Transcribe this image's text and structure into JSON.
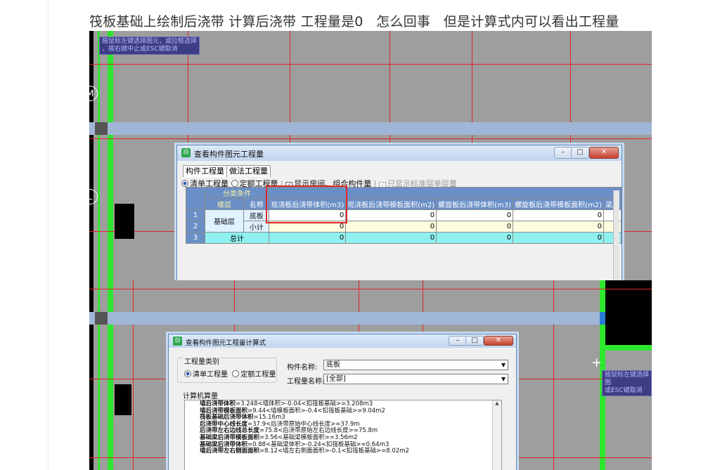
{
  "post": {
    "title": "筏板基础上绘制后浇带 计算后浇带 工程量是0   怎么回事   但是计算式内可以看出工程量"
  },
  "cad": {
    "hint_lines": [
      "按鼠标左键选择图元，或拉框选择",
      "，按右键中止或ESC键取消"
    ],
    "hint2_lines": [
      "按鼠标左键选择图",
      "或ESC键取消"
    ],
    "axis_labels": [
      "M",
      "L"
    ]
  },
  "dialog1": {
    "title": "查看构件图元工程量",
    "tabs": [
      "构件工程量",
      "做法工程量"
    ],
    "options": {
      "qingdan": "清单工程量",
      "dinge": "定额工程量",
      "show_floor": "显示房间、组合构件量",
      "only_std": "只显示标准层单层量"
    },
    "table": {
      "group_header": "分类条件",
      "col_floor": "楼层",
      "col_name": "名称",
      "columns": [
        "现浇板后浇带体积(m3)",
        "现浇板后浇带模板面积(m2)",
        "螺旋板后浇带体积(m3)",
        "螺旋板后浇带模板面积(m2)",
        "梁后"
      ],
      "rows": [
        {
          "num": "1",
          "floor": "基础层",
          "name": "底板",
          "values": [
            "0",
            "0",
            "0",
            "0"
          ]
        },
        {
          "num": "2",
          "floor": "",
          "name": "小计",
          "values": [
            "0",
            "0",
            "0",
            "0"
          ]
        },
        {
          "num": "3",
          "floor": "",
          "name": "总计",
          "values": [
            "0",
            "0",
            "0",
            "0"
          ]
        }
      ]
    }
  },
  "dialog2": {
    "title": "查看构件图元工程量计算式",
    "group_label": "工程量类别",
    "radio_qingdan": "清单工程量",
    "radio_dinge": "定额工程量",
    "component_label": "构件名称:",
    "component_value": "底板",
    "quantity_label": "工程量名称:",
    "quantity_value": "[全部]",
    "computer_calc": "计算机算量",
    "formula_lines": [
      {
        "name": "墙后浇带体积",
        "expr": "=3.248<墙体积>-0.04<扣筏板基础>=3.208m3"
      },
      {
        "name": "墙后浇带模板面积",
        "expr": "=9.44<墙模板面积>-0.4<扣筏板基础>=9.04m2"
      },
      {
        "name": "筏板基础后浇带体积",
        "expr": "=15.16m3"
      },
      {
        "name": "后浇带中心线长度",
        "expr": "=37.9<后浇带原始中心线长度>=37.9m"
      },
      {
        "name": "后浇带左右边线总长度",
        "expr": "=75.8<后浇带原始左右边线长度>=75.8m"
      },
      {
        "name": "基础梁后浇带模板面积",
        "expr": "=3.56<基础梁模板面积>=3.56m2"
      },
      {
        "name": "基础梁后浇带体积",
        "expr": "=0.88<基础梁体积>-0.24<扣筏板基础>=0.64m3"
      },
      {
        "name": "墙后浇带左右侧面面积",
        "expr": "=8.12<墙左右侧面面积>-0.1<扣筏板基础>=8.02m2"
      }
    ]
  }
}
